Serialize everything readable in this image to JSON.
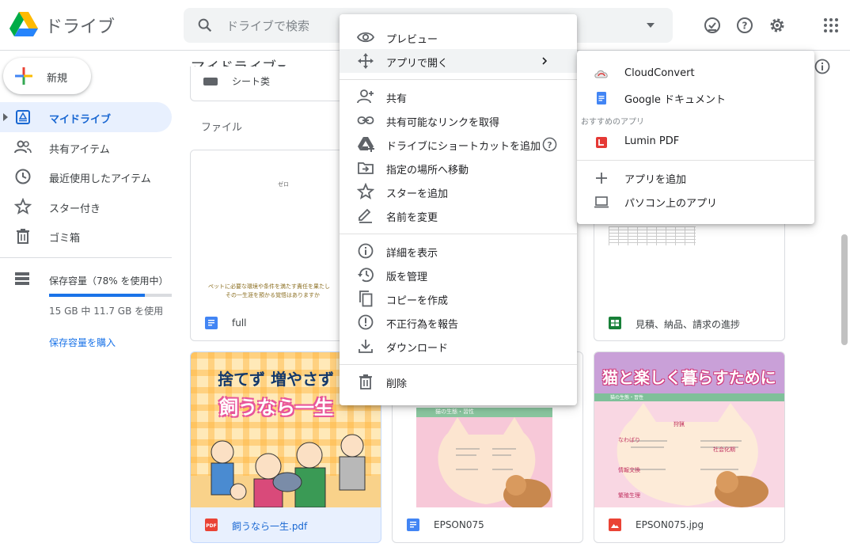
{
  "header": {
    "app_name": "ドライブ",
    "search_placeholder": "ドライブで検索"
  },
  "sidebar": {
    "new_label": "新規",
    "items": [
      {
        "label": "マイドライブ",
        "icon": "drive-icon",
        "active": true
      },
      {
        "label": "共有アイテム",
        "icon": "people-icon"
      },
      {
        "label": "最近使用したアイテム",
        "icon": "clock-icon"
      },
      {
        "label": "スター付き",
        "icon": "star-icon"
      },
      {
        "label": "ゴミ箱",
        "icon": "trash-icon"
      }
    ],
    "storage": {
      "label": "保存容量（78% を使用中）",
      "detail": "15 GB 中 11.7 GB を使用",
      "buy_link": "保存容量を購入",
      "percent_used": 78
    }
  },
  "main": {
    "title": "マイドライブ",
    "files_label": "ファイル",
    "partial_folder_label": "シート类",
    "files": [
      {
        "name": "full",
        "type": "doc",
        "thumb_lines": [
          "ゼロ",
          "ペットに必要な環境や条件を満たす責任を果たし",
          "その一生涯を預かる覚悟はありますか"
        ]
      },
      {
        "name": "見積、納品、請求の進捗",
        "type": "sheet"
      },
      {
        "name": "飼うなら一生.pdf",
        "type": "pdf",
        "selected": true,
        "thumb_lines": [
          "捨てず 増やさず",
          "飼うなら一生"
        ]
      },
      {
        "name": "EPSON075",
        "type": "doc",
        "thumb_lines": [
          "猫の生態・習性"
        ]
      },
      {
        "name": "EPSON075.jpg",
        "type": "image",
        "thumb_lines": [
          "猫と楽しく暮らすために",
          "猫の生態・習性",
          "狩猟",
          "なわばり",
          "社会化期",
          "情報交換",
          "繁殖生理"
        ]
      }
    ]
  },
  "context_menu": {
    "groups": [
      [
        {
          "label": "プレビュー",
          "icon": "eye-icon"
        },
        {
          "label": "アプリで開く",
          "icon": "move-arrows-icon",
          "submenu": true,
          "hover": true
        }
      ],
      [
        {
          "label": "共有",
          "icon": "person-add-icon"
        },
        {
          "label": "共有可能なリンクを取得",
          "icon": "link-icon"
        },
        {
          "label": "ドライブにショートカットを追加",
          "icon": "drive-shortcut-icon",
          "help": true
        },
        {
          "label": "指定の場所へ移動",
          "icon": "folder-move-icon"
        },
        {
          "label": "スターを追加",
          "icon": "star-icon"
        },
        {
          "label": "名前を変更",
          "icon": "pencil-icon"
        }
      ],
      [
        {
          "label": "詳細を表示",
          "icon": "info-icon"
        },
        {
          "label": "版を管理",
          "icon": "history-icon"
        },
        {
          "label": "コピーを作成",
          "icon": "copy-icon"
        },
        {
          "label": "不正行為を報告",
          "icon": "report-icon"
        },
        {
          "label": "ダウンロード",
          "icon": "download-icon"
        }
      ],
      [
        {
          "label": "削除",
          "icon": "trash-icon"
        }
      ]
    ]
  },
  "submenu": {
    "apps": [
      {
        "label": "CloudConvert",
        "icon": "cloudconvert-icon"
      },
      {
        "label": "Google ドキュメント",
        "icon": "google-docs-icon"
      }
    ],
    "suggested_header": "おすすめのアプリ",
    "suggested": [
      {
        "label": "Lumin PDF",
        "icon": "lumin-pdf-icon"
      }
    ],
    "actions": [
      {
        "label": "アプリを追加",
        "icon": "plus-icon"
      },
      {
        "label": "パソコン上のアプリ",
        "icon": "laptop-icon"
      }
    ]
  },
  "colors": {
    "accent": "#1a73e8",
    "active_bg": "#e8f0fe",
    "pdf_red": "#ea4335",
    "sheet_green": "#188038",
    "doc_blue": "#4285f4"
  }
}
